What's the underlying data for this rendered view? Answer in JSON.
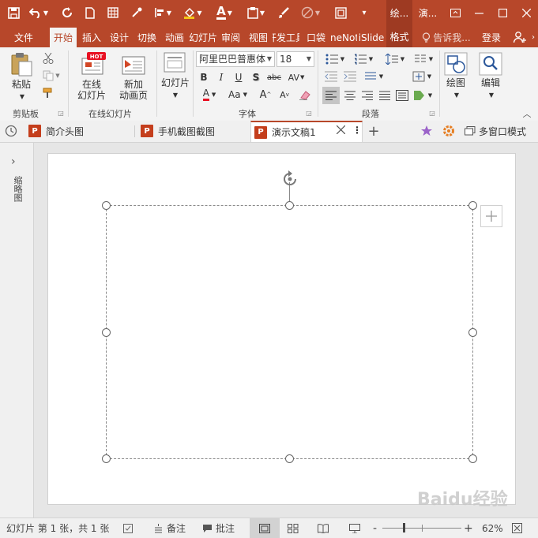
{
  "quick_access": {
    "save": "save-icon",
    "undo": "undo-icon",
    "redo": "redo-icon",
    "new": "new-file-icon",
    "grid": "grid-icon",
    "eyedropper": "eyedropper-icon",
    "align": "align-icon",
    "fill": "fill-icon",
    "font_color": "font-color-icon",
    "paste": "paste-icon",
    "brush": "brush-icon",
    "shape": "shape-icon",
    "select": "select-icon"
  },
  "context_tabs": [
    "绘...",
    "演..."
  ],
  "tabs": [
    "文件",
    "开始",
    "插入",
    "设计",
    "切换",
    "动画",
    "幻灯片",
    "审阅",
    "视图",
    "开发工具",
    "口袋",
    "OneNote",
    "iSlide",
    "格式"
  ],
  "tell_me": "告诉我...",
  "login": "登录",
  "ribbon": {
    "clipboard": {
      "paste": "粘贴",
      "label": "剪贴板"
    },
    "online": {
      "online_slides": "在线\n幻灯片",
      "new_slide": "新加\n动画页",
      "label": "在线幻灯片",
      "hot": "HOT"
    },
    "slides": {
      "slide": "幻灯片"
    },
    "font": {
      "name": "阿里巴巴普惠体",
      "size": "18",
      "label": "字体",
      "bold": "B",
      "italic": "I",
      "underline": "U",
      "shadow": "S",
      "strike": "abc",
      "spacing": "AV",
      "color": "A",
      "case": "Aa",
      "grow": "A",
      "shrink": "A"
    },
    "paragraph": {
      "label": "段落"
    },
    "drawing": {
      "label": "绘图"
    },
    "editing": {
      "label": "编辑"
    }
  },
  "doc_tabs": [
    {
      "name": "简介头图",
      "icon": "P"
    },
    {
      "name": "手机截图截图",
      "icon": "P"
    },
    {
      "name": "演示文稿1",
      "icon": "P",
      "active": true
    }
  ],
  "doc_tabs_right": {
    "multi_window": "多窗口模式"
  },
  "left_panel": {
    "label": "缩略图",
    "expand": "›"
  },
  "status": {
    "slide_info": "幻灯片 第 1 张，共 1 张",
    "notes": "备注",
    "comments": "批注",
    "zoom": "62%",
    "minus": "-",
    "plus": "+"
  },
  "watermark": "Baidu经验"
}
